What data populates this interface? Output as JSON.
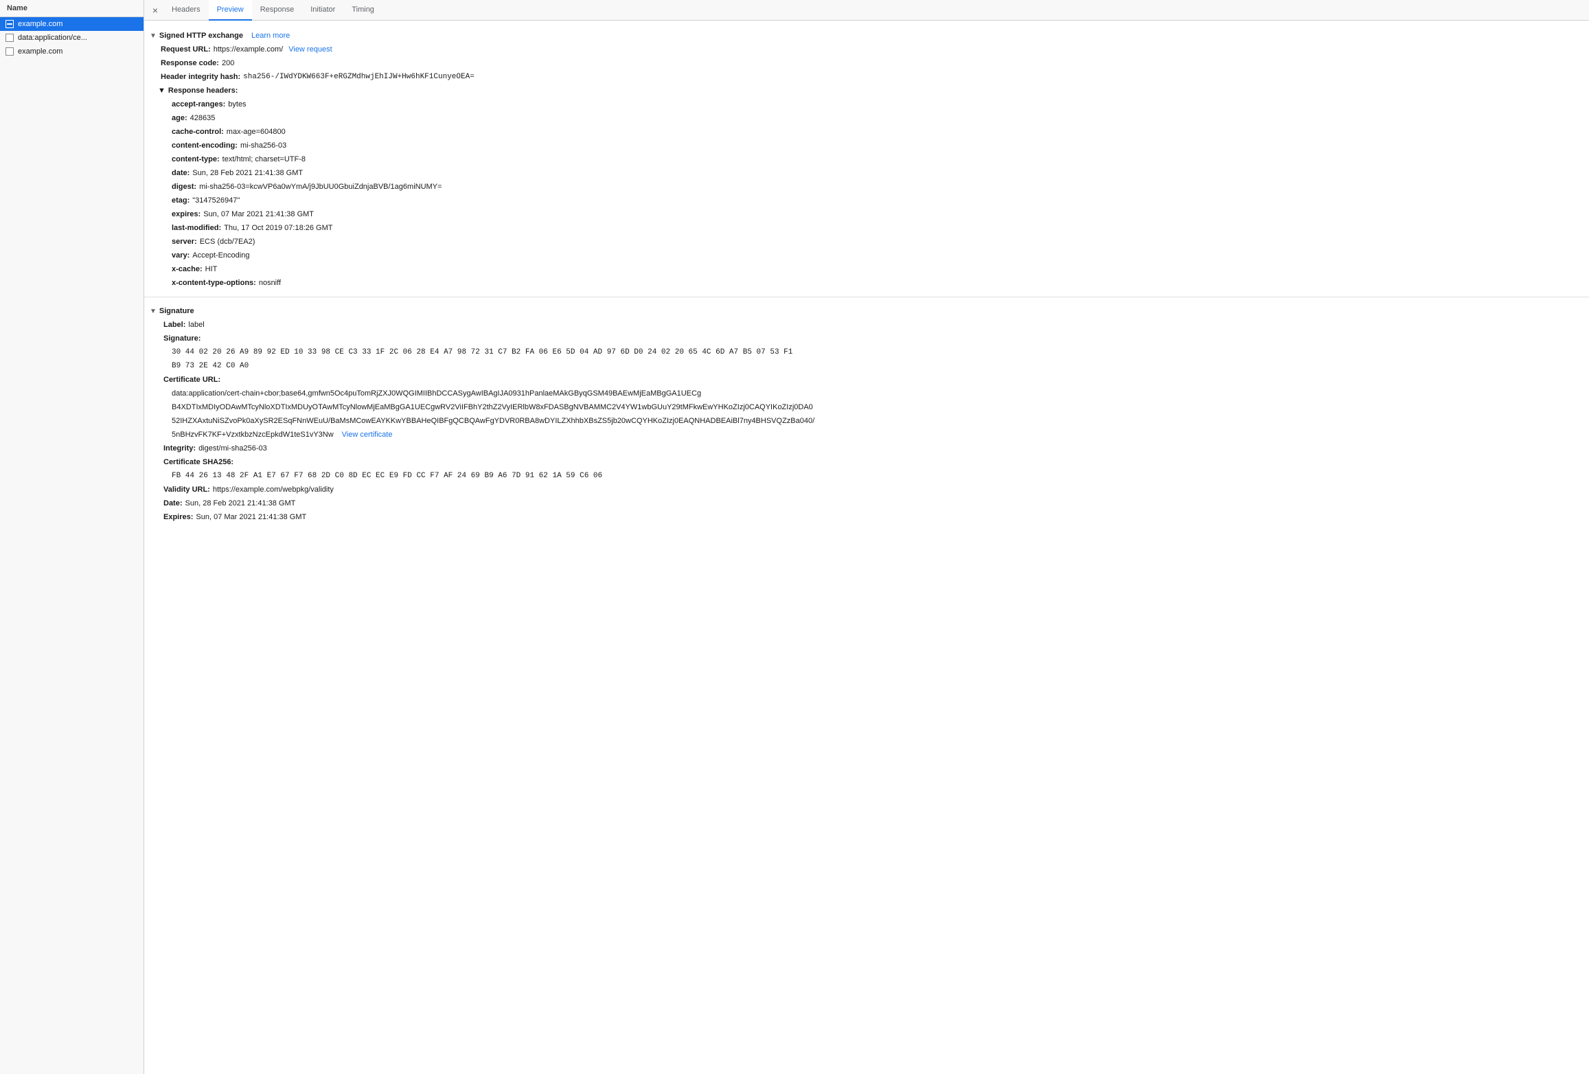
{
  "leftPanel": {
    "header": "Name",
    "items": [
      {
        "id": "example-com-1",
        "label": "example.com",
        "active": true,
        "icon": "page"
      },
      {
        "id": "data-application",
        "label": "data:application/ce...",
        "active": false,
        "icon": "page"
      },
      {
        "id": "example-com-2",
        "label": "example.com",
        "active": false,
        "icon": "page"
      }
    ]
  },
  "tabs": {
    "close_symbol": "×",
    "items": [
      {
        "id": "tab-headers",
        "label": "Headers",
        "active": false
      },
      {
        "id": "tab-preview",
        "label": "Preview",
        "active": true
      },
      {
        "id": "tab-response",
        "label": "Response",
        "active": false
      },
      {
        "id": "tab-initiator",
        "label": "Initiator",
        "active": false
      },
      {
        "id": "tab-timing",
        "label": "Timing",
        "active": false
      }
    ]
  },
  "preview": {
    "signedHttpExchange": {
      "sectionLabel": "Signed HTTP exchange",
      "learnMoreLabel": "Learn more",
      "requestUrlLabel": "Request URL:",
      "requestUrlValue": "https://example.com/",
      "viewRequestLabel": "View request",
      "responseCodeLabel": "Response code:",
      "responseCodeValue": "200",
      "headerIntegrityHashLabel": "Header integrity hash:",
      "headerIntegrityHashValue": "sha256-/IWdYDKW663F+eRGZMdhwjEhIJW+Hw6hKF1CunyeOEA=",
      "responseHeaders": {
        "sectionLabel": "Response headers:",
        "fields": [
          {
            "label": "accept-ranges:",
            "value": "bytes"
          },
          {
            "label": "age:",
            "value": "428635"
          },
          {
            "label": "cache-control:",
            "value": "max-age=604800"
          },
          {
            "label": "content-encoding:",
            "value": "mi-sha256-03"
          },
          {
            "label": "content-type:",
            "value": "text/html; charset=UTF-8"
          },
          {
            "label": "date:",
            "value": "Sun, 28 Feb 2021 21:41:38 GMT"
          },
          {
            "label": "digest:",
            "value": "mi-sha256-03=kcwVP6a0wYmA/j9JbUU0GbuiZdnjaBVB/1ag6miNUMY="
          },
          {
            "label": "etag:",
            "value": "\"3147526947\""
          },
          {
            "label": "expires:",
            "value": "Sun, 07 Mar 2021 21:41:38 GMT"
          },
          {
            "label": "last-modified:",
            "value": "Thu, 17 Oct 2019 07:18:26 GMT"
          },
          {
            "label": "server:",
            "value": "ECS (dcb/7EA2)"
          },
          {
            "label": "vary:",
            "value": "Accept-Encoding"
          },
          {
            "label": "x-cache:",
            "value": "HIT"
          },
          {
            "label": "x-content-type-options:",
            "value": "nosniff"
          }
        ]
      }
    },
    "signature": {
      "sectionLabel": "Signature",
      "labelFieldLabel": "Label:",
      "labelFieldValue": "label",
      "signatureFieldLabel": "Signature:",
      "signatureRow1": "30 44 02 20 26 A9 89 92 ED 10 33 98 CE C3 33 1F 2C 06 28 E4 A7 98 72 31 C7 B2 FA 06 E6 5D 04 AD 97 6D D0 24 02 20 65 4C 6D A7 B5 07 53 F1",
      "signatureRow2": "B9 73 2E 42 C0 A0",
      "certUrlLabel": "Certificate URL:",
      "certUrlValue": "data:application/cert-chain+cbor;base64,gmfwn5Oc4puTomRjZXJ0WQGIMIIBhDCCASygAwIBAgIJA0931hPanlaeMAkGByqGSM49BAEwMjEaMBgGA1UECg",
      "certUrlValue2": "B4XDTIxMDIyODAwMTcyNloXDTIxMDUyOTAwMTcyNlowMjEaMBgGA1UECgwRV2ViIFBhY2thZ2VyIERlbW8xFDASBgNVBAMMC2V4YW1wbGUuY29tMFkwEwYHKoZIzj0CAQYIKoZIzj0DA0",
      "certUrlValue3": "52IHZXAxtuNiSZvoPk0aXySR2ESqFNnWEuU/BaMsMCowEAYKKwYBBAHeQIBFgQCBQAwFgYDVR0RBA8wDYILZXhhbXBsZS5jb20wCQYHKoZIzj0EAQNHADBEAiBl7ny4BHSVQZzBa040/",
      "certUrlValue4": "5nBHzvFK7KF+VzxtkbzNzcEpkdW1teS1vY3Nw",
      "viewCertificateLabel": "View certificate",
      "integrityLabel": "Integrity:",
      "integrityValue": "digest/mi-sha256-03",
      "certSha256Label": "Certificate SHA256:",
      "certSha256Value": "FB 44 26 13 48 2F A1 E7 67 F7 68 2D C0 8D EC EC E9 FD CC F7 AF 24 69 B9 A6 7D 91 62 1A 59 C6 06",
      "validityUrlLabel": "Validity URL:",
      "validityUrlValue": "https://example.com/webpkg/validity",
      "dateLabel": "Date:",
      "dateValue": "Sun, 28 Feb 2021 21:41:38 GMT",
      "expiresLabel": "Expires:",
      "expiresValue": "Sun, 07 Mar 2021 21:41:38 GMT"
    }
  }
}
